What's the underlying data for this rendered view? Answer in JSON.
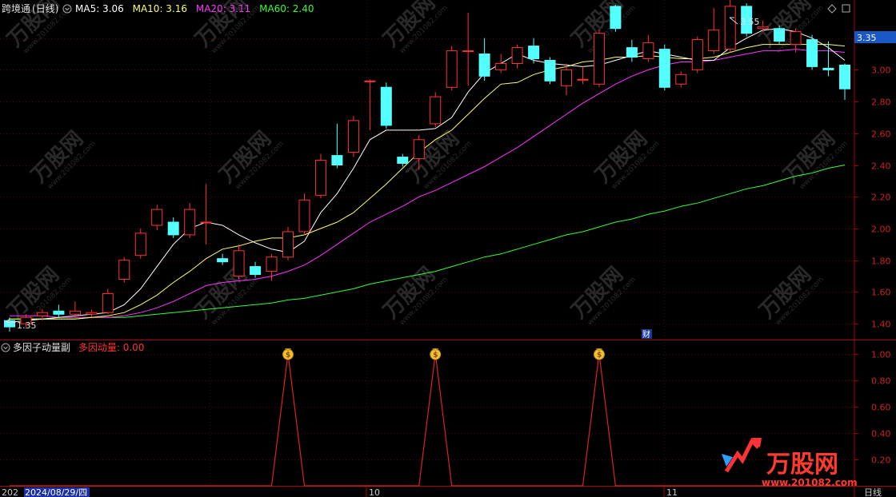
{
  "header": {
    "stock_name": "跨境通",
    "period": "(日线)",
    "ma_items": [
      {
        "label": "MA5: 3.06",
        "color": "#ffffff"
      },
      {
        "label": "MA10: 3.16",
        "color": "#ffff66"
      },
      {
        "label": "MA20: 3.11",
        "color": "#ff33ff"
      },
      {
        "label": "MA60: 2.40",
        "color": "#33ff33"
      }
    ]
  },
  "sub_header": {
    "indicator_name": "多因子动量副",
    "indicator_value": "多因动量: 0.00"
  },
  "price_tag": "3.35",
  "high_mark": "3.55",
  "low_mark": "1.35",
  "fin_badge": "财",
  "bottom_bar": {
    "date_prefix": "202",
    "current_date": "2024/08/29/四",
    "month_labels": [
      "10",
      "11"
    ],
    "period_label": "日线"
  },
  "watermark": {
    "brand": "万股网",
    "url": "www.201082.com"
  },
  "colors": {
    "up": "#ff3333",
    "down": "#54ffff",
    "grid": "#550000",
    "axis": "#b00000",
    "ma5": "#ffffff",
    "ma10": "#ffff66",
    "ma20": "#ff33ff",
    "ma60": "#33ff33",
    "indicator": "#dd2222"
  },
  "chart_data": {
    "type": "candlestick",
    "main_axis": {
      "ylim": [
        1.3,
        3.44
      ],
      "ticks": [
        "3.20",
        "3.00",
        "2.80",
        "2.60",
        "2.40",
        "2.20",
        "2.00",
        "1.80",
        "1.60",
        "1.40"
      ]
    },
    "sub_axis": {
      "ylim": [
        0,
        1.1
      ],
      "ticks": [
        "1.00",
        "0.80",
        "0.60",
        "0.40",
        "0.20"
      ]
    },
    "candles": [
      {
        "o": 1.42,
        "c": 1.38,
        "h": 1.44,
        "l": 1.35
      },
      {
        "o": 1.4,
        "c": 1.44,
        "h": 1.46,
        "l": 1.38
      },
      {
        "o": 1.45,
        "c": 1.47,
        "h": 1.49,
        "l": 1.42
      },
      {
        "o": 1.48,
        "c": 1.46,
        "h": 1.52,
        "l": 1.44
      },
      {
        "o": 1.46,
        "c": 1.48,
        "h": 1.54,
        "l": 1.44
      },
      {
        "o": 1.46,
        "c": 1.47,
        "h": 1.49,
        "l": 1.44
      },
      {
        "o": 1.47,
        "c": 1.59,
        "h": 1.62,
        "l": 1.46
      },
      {
        "o": 1.68,
        "c": 1.8,
        "h": 1.82,
        "l": 1.66
      },
      {
        "o": 1.83,
        "c": 1.97,
        "h": 2.0,
        "l": 1.81
      },
      {
        "o": 2.02,
        "c": 2.12,
        "h": 2.15,
        "l": 1.99
      },
      {
        "o": 2.04,
        "c": 1.96,
        "h": 2.07,
        "l": 1.94
      },
      {
        "o": 1.96,
        "c": 2.12,
        "h": 2.16,
        "l": 1.94
      },
      {
        "o": 2.04,
        "c": 2.04,
        "h": 2.28,
        "l": 1.9
      },
      {
        "o": 1.81,
        "c": 1.79,
        "h": 1.84,
        "l": 1.77
      },
      {
        "o": 1.7,
        "c": 1.86,
        "h": 1.9,
        "l": 1.68
      },
      {
        "o": 1.76,
        "c": 1.71,
        "h": 1.79,
        "l": 1.69
      },
      {
        "o": 1.73,
        "c": 1.82,
        "h": 1.84,
        "l": 1.67
      },
      {
        "o": 1.82,
        "c": 1.98,
        "h": 2.01,
        "l": 1.8
      },
      {
        "o": 1.98,
        "c": 2.18,
        "h": 2.22,
        "l": 1.96
      },
      {
        "o": 2.21,
        "c": 2.43,
        "h": 2.47,
        "l": 2.19
      },
      {
        "o": 2.46,
        "c": 2.4,
        "h": 2.66,
        "l": 2.38
      },
      {
        "o": 2.48,
        "c": 2.68,
        "h": 2.71,
        "l": 2.45
      },
      {
        "o": 2.93,
        "c": 2.93,
        "h": 2.94,
        "l": 2.62
      },
      {
        "o": 2.89,
        "c": 2.65,
        "h": 2.92,
        "l": 2.63
      },
      {
        "o": 2.45,
        "c": 2.41,
        "h": 2.47,
        "l": 2.39
      },
      {
        "o": 2.44,
        "c": 2.56,
        "h": 2.59,
        "l": 2.37
      },
      {
        "o": 2.66,
        "c": 2.83,
        "h": 2.86,
        "l": 2.64
      },
      {
        "o": 2.89,
        "c": 3.12,
        "h": 3.15,
        "l": 2.87
      },
      {
        "o": 3.12,
        "c": 3.12,
        "h": 3.36,
        "l": 2.9
      },
      {
        "o": 3.1,
        "c": 2.96,
        "h": 3.2,
        "l": 2.93
      },
      {
        "o": 3.0,
        "c": 3.04,
        "h": 3.1,
        "l": 2.98
      },
      {
        "o": 3.04,
        "c": 3.14,
        "h": 3.16,
        "l": 3.01
      },
      {
        "o": 3.15,
        "c": 3.07,
        "h": 3.2,
        "l": 3.04
      },
      {
        "o": 3.06,
        "c": 2.93,
        "h": 3.08,
        "l": 2.91
      },
      {
        "o": 2.9,
        "c": 3.0,
        "h": 3.04,
        "l": 2.84
      },
      {
        "o": 2.94,
        "c": 2.94,
        "h": 3.02,
        "l": 2.91
      },
      {
        "o": 2.91,
        "c": 3.23,
        "h": 3.25,
        "l": 2.89
      },
      {
        "o": 3.4,
        "c": 3.26,
        "h": 3.41,
        "l": 3.24
      },
      {
        "o": 3.14,
        "c": 3.08,
        "h": 3.19,
        "l": 3.05
      },
      {
        "o": 3.07,
        "c": 3.17,
        "h": 3.22,
        "l": 3.05
      },
      {
        "o": 3.13,
        "c": 2.89,
        "h": 3.16,
        "l": 2.87
      },
      {
        "o": 2.91,
        "c": 2.97,
        "h": 2.99,
        "l": 2.89
      },
      {
        "o": 3.0,
        "c": 3.19,
        "h": 3.21,
        "l": 2.98
      },
      {
        "o": 3.12,
        "c": 3.25,
        "h": 3.39,
        "l": 3.1
      },
      {
        "o": 3.13,
        "c": 3.4,
        "h": 3.55,
        "l": 3.11
      },
      {
        "o": 3.4,
        "c": 3.23,
        "h": 3.42,
        "l": 3.21
      },
      {
        "o": 3.26,
        "c": 3.27,
        "h": 3.31,
        "l": 3.24
      },
      {
        "o": 3.26,
        "c": 3.18,
        "h": 3.28,
        "l": 3.16
      },
      {
        "o": 3.16,
        "c": 3.24,
        "h": 3.26,
        "l": 3.11
      },
      {
        "o": 3.19,
        "c": 3.02,
        "h": 3.22,
        "l": 3.0
      },
      {
        "o": 3.01,
        "c": 3.0,
        "h": 3.18,
        "l": 2.96
      },
      {
        "o": 3.03,
        "c": 2.88,
        "h": 3.04,
        "l": 2.81
      }
    ],
    "ma5": [
      1.41,
      1.42,
      1.43,
      1.44,
      1.45,
      1.46,
      1.47,
      1.52,
      1.62,
      1.76,
      1.9,
      2.0,
      2.04,
      2.02,
      1.96,
      1.91,
      1.87,
      1.85,
      1.92,
      2.1,
      2.22,
      2.38,
      2.56,
      2.62,
      2.62,
      2.62,
      2.63,
      2.7,
      2.86,
      2.98,
      3.04,
      3.1,
      3.06,
      3.04,
      3.03,
      3.02,
      3.03,
      3.06,
      3.09,
      3.12,
      3.1,
      3.08,
      3.06,
      3.06,
      3.14,
      3.2,
      3.25,
      3.26,
      3.24,
      3.2,
      3.14,
      3.06
    ],
    "ma10": [
      1.43,
      1.43,
      1.43,
      1.43,
      1.43,
      1.44,
      1.45,
      1.47,
      1.52,
      1.58,
      1.66,
      1.73,
      1.81,
      1.87,
      1.89,
      1.92,
      1.94,
      1.94,
      1.96,
      2.0,
      2.04,
      2.1,
      2.19,
      2.28,
      2.38,
      2.48,
      2.56,
      2.62,
      2.72,
      2.82,
      2.91,
      2.92,
      2.97,
      3.0,
      3.02,
      3.05,
      3.06,
      3.08,
      3.08,
      3.09,
      3.08,
      3.07,
      3.07,
      3.08,
      3.11,
      3.14,
      3.16,
      3.16,
      3.16,
      3.16,
      3.16,
      3.15
    ],
    "ma20": [
      1.45,
      1.45,
      1.45,
      1.44,
      1.44,
      1.44,
      1.44,
      1.45,
      1.47,
      1.5,
      1.54,
      1.59,
      1.64,
      1.66,
      1.67,
      1.68,
      1.7,
      1.73,
      1.77,
      1.83,
      1.9,
      1.97,
      2.04,
      2.09,
      2.14,
      2.2,
      2.24,
      2.29,
      2.34,
      2.39,
      2.45,
      2.51,
      2.58,
      2.65,
      2.72,
      2.79,
      2.85,
      2.91,
      2.96,
      3.0,
      3.03,
      3.05,
      3.05,
      3.06,
      3.08,
      3.1,
      3.12,
      3.12,
      3.13,
      3.12,
      3.12,
      3.11
    ],
    "ma60": [
      1.43,
      1.43,
      1.43,
      1.43,
      1.43,
      1.44,
      1.44,
      1.44,
      1.45,
      1.46,
      1.47,
      1.48,
      1.49,
      1.5,
      1.51,
      1.52,
      1.53,
      1.55,
      1.56,
      1.58,
      1.6,
      1.62,
      1.65,
      1.67,
      1.69,
      1.71,
      1.73,
      1.76,
      1.79,
      1.82,
      1.84,
      1.87,
      1.9,
      1.93,
      1.96,
      1.98,
      2.01,
      2.04,
      2.06,
      2.09,
      2.11,
      2.14,
      2.16,
      2.19,
      2.22,
      2.25,
      2.27,
      2.3,
      2.33,
      2.35,
      2.38,
      2.4
    ],
    "momentum": [
      0,
      0,
      0,
      0,
      0,
      0,
      0,
      0,
      0,
      0,
      0,
      0,
      0,
      0,
      0,
      0,
      0,
      1,
      0,
      0,
      0,
      0,
      0,
      0,
      0,
      0,
      1,
      0,
      0,
      0,
      0,
      0,
      0,
      0,
      0,
      0,
      1,
      0,
      0,
      0,
      0,
      0,
      0,
      0,
      0,
      0,
      0,
      0,
      0,
      0,
      0,
      0
    ]
  }
}
